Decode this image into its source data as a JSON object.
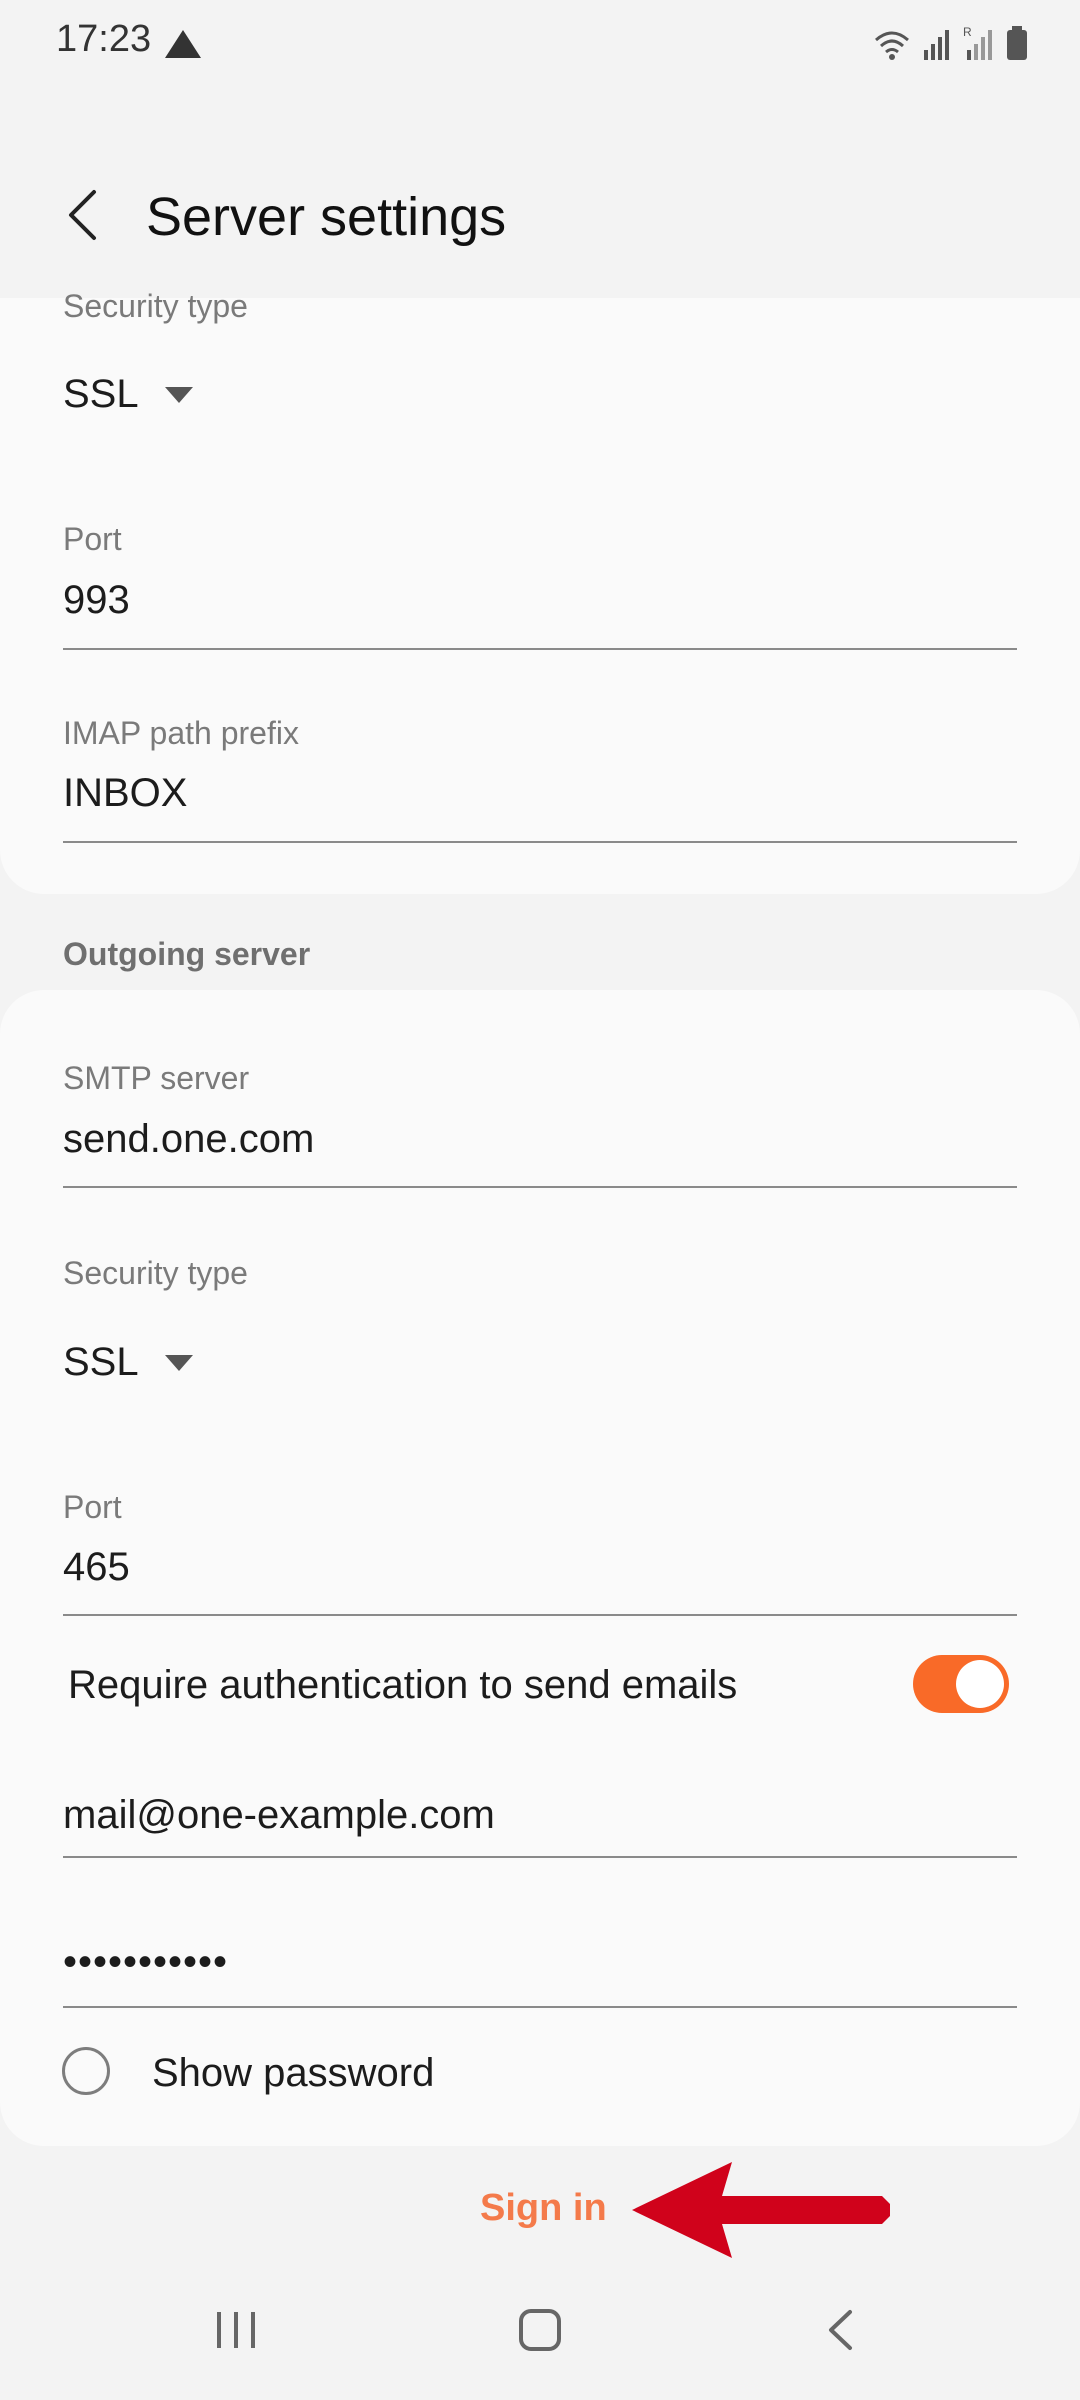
{
  "status_bar": {
    "time": "17:23"
  },
  "header": {
    "title": "Server settings"
  },
  "incoming": {
    "security_label": "Security type",
    "security_value": "SSL",
    "port_label": "Port",
    "port_value": "993",
    "imap_label": "IMAP path prefix",
    "imap_value": "INBOX"
  },
  "outgoing": {
    "section_title": "Outgoing server",
    "smtp_label": "SMTP server",
    "smtp_value": "send.one.com",
    "security_label": "Security type",
    "security_value": "SSL",
    "port_label": "Port",
    "port_value": "465",
    "auth_label": "Require authentication to send emails",
    "auth_enabled": true,
    "username_value": "mail@one-example.com",
    "password_value": "•••••••••••",
    "show_password_label": "Show password"
  },
  "actions": {
    "sign_in": "Sign in"
  },
  "colors": {
    "accent": "#f96a28",
    "annotation_arrow": "#d0021b",
    "sign_in_text": "#f47a4a"
  },
  "icons": [
    "back-arrow-icon",
    "warning-icon",
    "wifi-icon",
    "signal-icon",
    "battery-icon",
    "recents-icon",
    "home-icon",
    "nav-back-icon"
  ]
}
